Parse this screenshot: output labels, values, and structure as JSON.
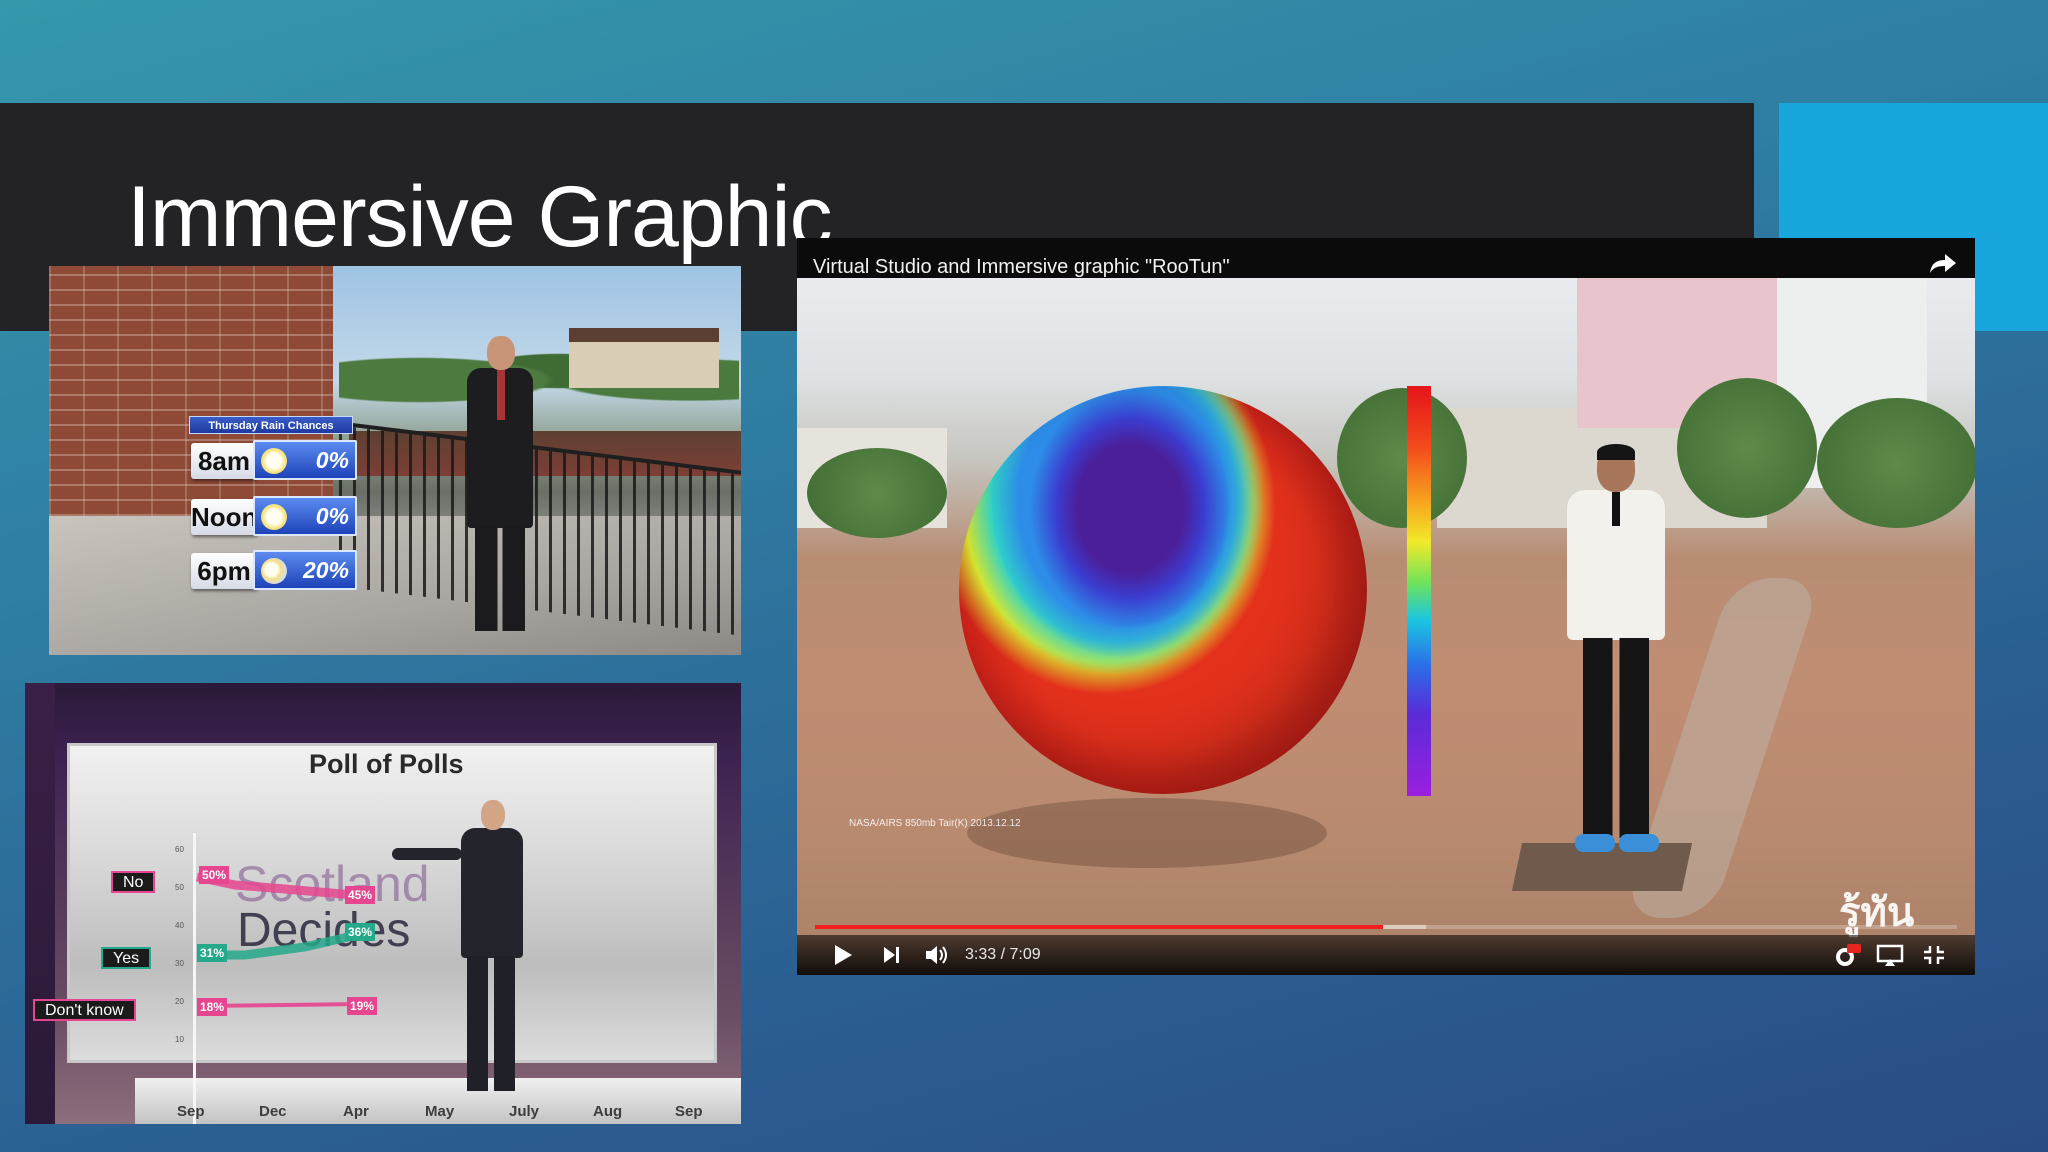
{
  "slide": {
    "title": "Immersive Graphic",
    "colors": {
      "title_band": "#232326",
      "accent_square": "#19a6dc",
      "background": "#2f7ea3"
    }
  },
  "weather_panel": {
    "widget_title": "Thursday Rain Chances",
    "rows": [
      {
        "time": "8am",
        "icon": "sun-icon",
        "percent": "0%"
      },
      {
        "time": "Noon",
        "icon": "sun-icon",
        "percent": "0%"
      },
      {
        "time": "6pm",
        "icon": "sun-cloud-icon",
        "percent": "20%"
      }
    ]
  },
  "poll_panel": {
    "title": "Poll of Polls",
    "background_text_1": "Scotland",
    "background_text_2": "Decides",
    "labels": [
      {
        "text": "No",
        "color": "#e6458f"
      },
      {
        "text": "Yes",
        "color": "#24a98a"
      },
      {
        "text": "Don't know",
        "color": "#e6458f"
      }
    ],
    "values": [
      "50%",
      "45%",
      "31%",
      "36%",
      "18%",
      "19%"
    ],
    "y_ticks": [
      "60",
      "50",
      "40",
      "30",
      "20",
      "10"
    ],
    "months": [
      "Sep",
      "Dec",
      "Apr",
      "May",
      "July",
      "Aug",
      "Sep"
    ]
  },
  "video_player": {
    "title": "Virtual Studio and Immersive graphic \"RooTun\"",
    "globe_caption": "NASA/AIRS 850mb Tair(K) 2013.12.12",
    "watermark": "รู้ทัน",
    "current_time": "3:33",
    "duration": "7:09",
    "time_display": "3:33 / 7:09",
    "progress_fraction": 0.497,
    "buffer_fraction": 0.535,
    "icons": [
      "share-icon",
      "play-icon",
      "next-icon",
      "volume-icon",
      "settings-hd-icon",
      "airplay-icon",
      "exit-fullscreen-icon"
    ],
    "progress_color": "#f31f1f"
  }
}
